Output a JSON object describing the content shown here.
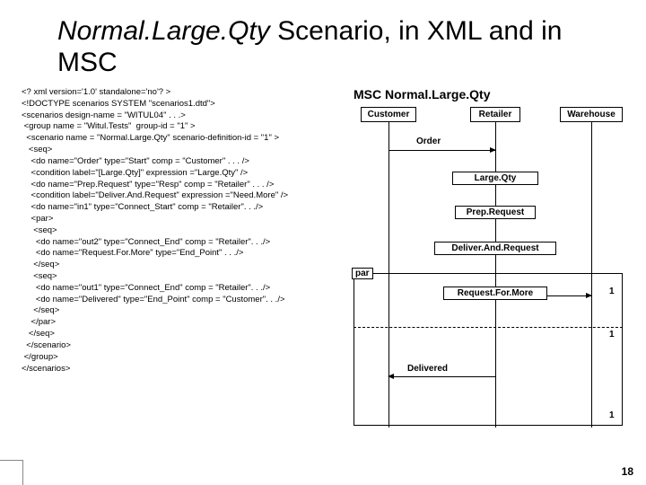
{
  "title": {
    "italic": "Normal.Large.Qty",
    "rest": " Scenario, in XML and in MSC"
  },
  "xml": "<? xml version='1.0' standalone='no'? >\n<!DOCTYPE scenarios SYSTEM \"scenarios1.dtd\">\n<scenarios design-name = \"WITUL04\" . . .>\n <group name = \"Witul.Tests\"  group-id = \"1\" >\n  <scenario name = \"Normal.Large.Qty\" scenario-definition-id = \"1\" >\n   <seq>\n    <do name=\"Order\" type=\"Start\" comp = \"Customer\" . . . />\n    <condition label=\"[Large.Qty]\" expression =\"Large.Qty\" />\n    <do name=\"Prep.Request\" type=\"Resp\" comp = \"Retailer\" . . . />\n    <condition label=\"Deliver.And.Request\" expression =\"Need.More\" />\n    <do name=\"in1\" type=\"Connect_Start\" comp = \"Retailer\". . ./>\n    <par>\n     <seq>\n      <do name=\"out2\" type=\"Connect_End\" comp = \"Retailer\". . ./>\n      <do name=\"Request.For.More\" type=\"End_Point\" . . ./>\n     </seq>\n     <seq>\n      <do name=\"out1\" type=\"Connect_End\" comp = \"Retailer\". . ./>\n      <do name=\"Delivered\" type=\"End_Point\" comp = \"Customer\". . ./>\n     </seq>\n    </par>\n   </seq>\n  </scenario>\n </group>\n</scenarios>",
  "msc": {
    "title": "MSC Normal.Large.Qty",
    "actors": {
      "customer": "Customer",
      "retailer": "Retailer",
      "warehouse": "Warehouse"
    },
    "messages": {
      "order": "Order",
      "largeQty": "Large.Qty",
      "prepRequest": "Prep.Request",
      "deliverAndRequest": "Deliver.And.Request",
      "requestForMore": "Request.For.More",
      "delivered": "Delivered"
    },
    "par": "par",
    "ones": {
      "a": "1",
      "b": "1",
      "c": "1"
    }
  },
  "page": "18"
}
